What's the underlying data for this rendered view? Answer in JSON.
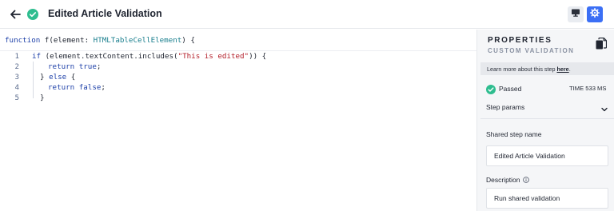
{
  "header": {
    "title": "Edited Article Validation"
  },
  "editor": {
    "signature": {
      "keyword": "function",
      "name_part": " f(element: ",
      "type": "HTMLTableCellElement",
      "tail": ") {"
    },
    "line_numbers": [
      "1",
      "2",
      "3",
      "4",
      "5"
    ],
    "lines": {
      "l1_kw": "if",
      "l1_a": " (element.textContent.includes(",
      "l1_str": "\"This is edited\"",
      "l1_b": ")) {",
      "l2_kw": "return",
      "l2_val": " true",
      "l2_tail": ";",
      "l3_a": "} ",
      "l3_kw": "else",
      "l3_b": " {",
      "l4_kw": "return",
      "l4_val": " false",
      "l4_tail": ";",
      "l5": "}"
    }
  },
  "panel": {
    "title": "PROPERTIES",
    "subtitle": "CUSTOM VALIDATION",
    "learn_text": "Learn more about this step ",
    "learn_link": "here",
    "learn_end": ".",
    "status": "Passed",
    "time": "TIME 533 MS",
    "step_params": "Step params",
    "shared_step_label": "Shared step name",
    "shared_step_value": "Edited Article Validation",
    "description_label": "Description",
    "description_value": "Run shared validation"
  },
  "colors": {
    "accent": "#3b6ff5",
    "success": "#2ebd8f",
    "keyword": "#1c3fa8",
    "type": "#1a7f8e",
    "string": "#b31d28"
  },
  "icons": {
    "back": "arrow-left-icon",
    "status": "check-circle-icon",
    "monitor": "monitor-icon",
    "settings": "gear-icon",
    "copy": "copy-icon",
    "chevron": "chevron-down-icon",
    "info": "info-icon"
  }
}
